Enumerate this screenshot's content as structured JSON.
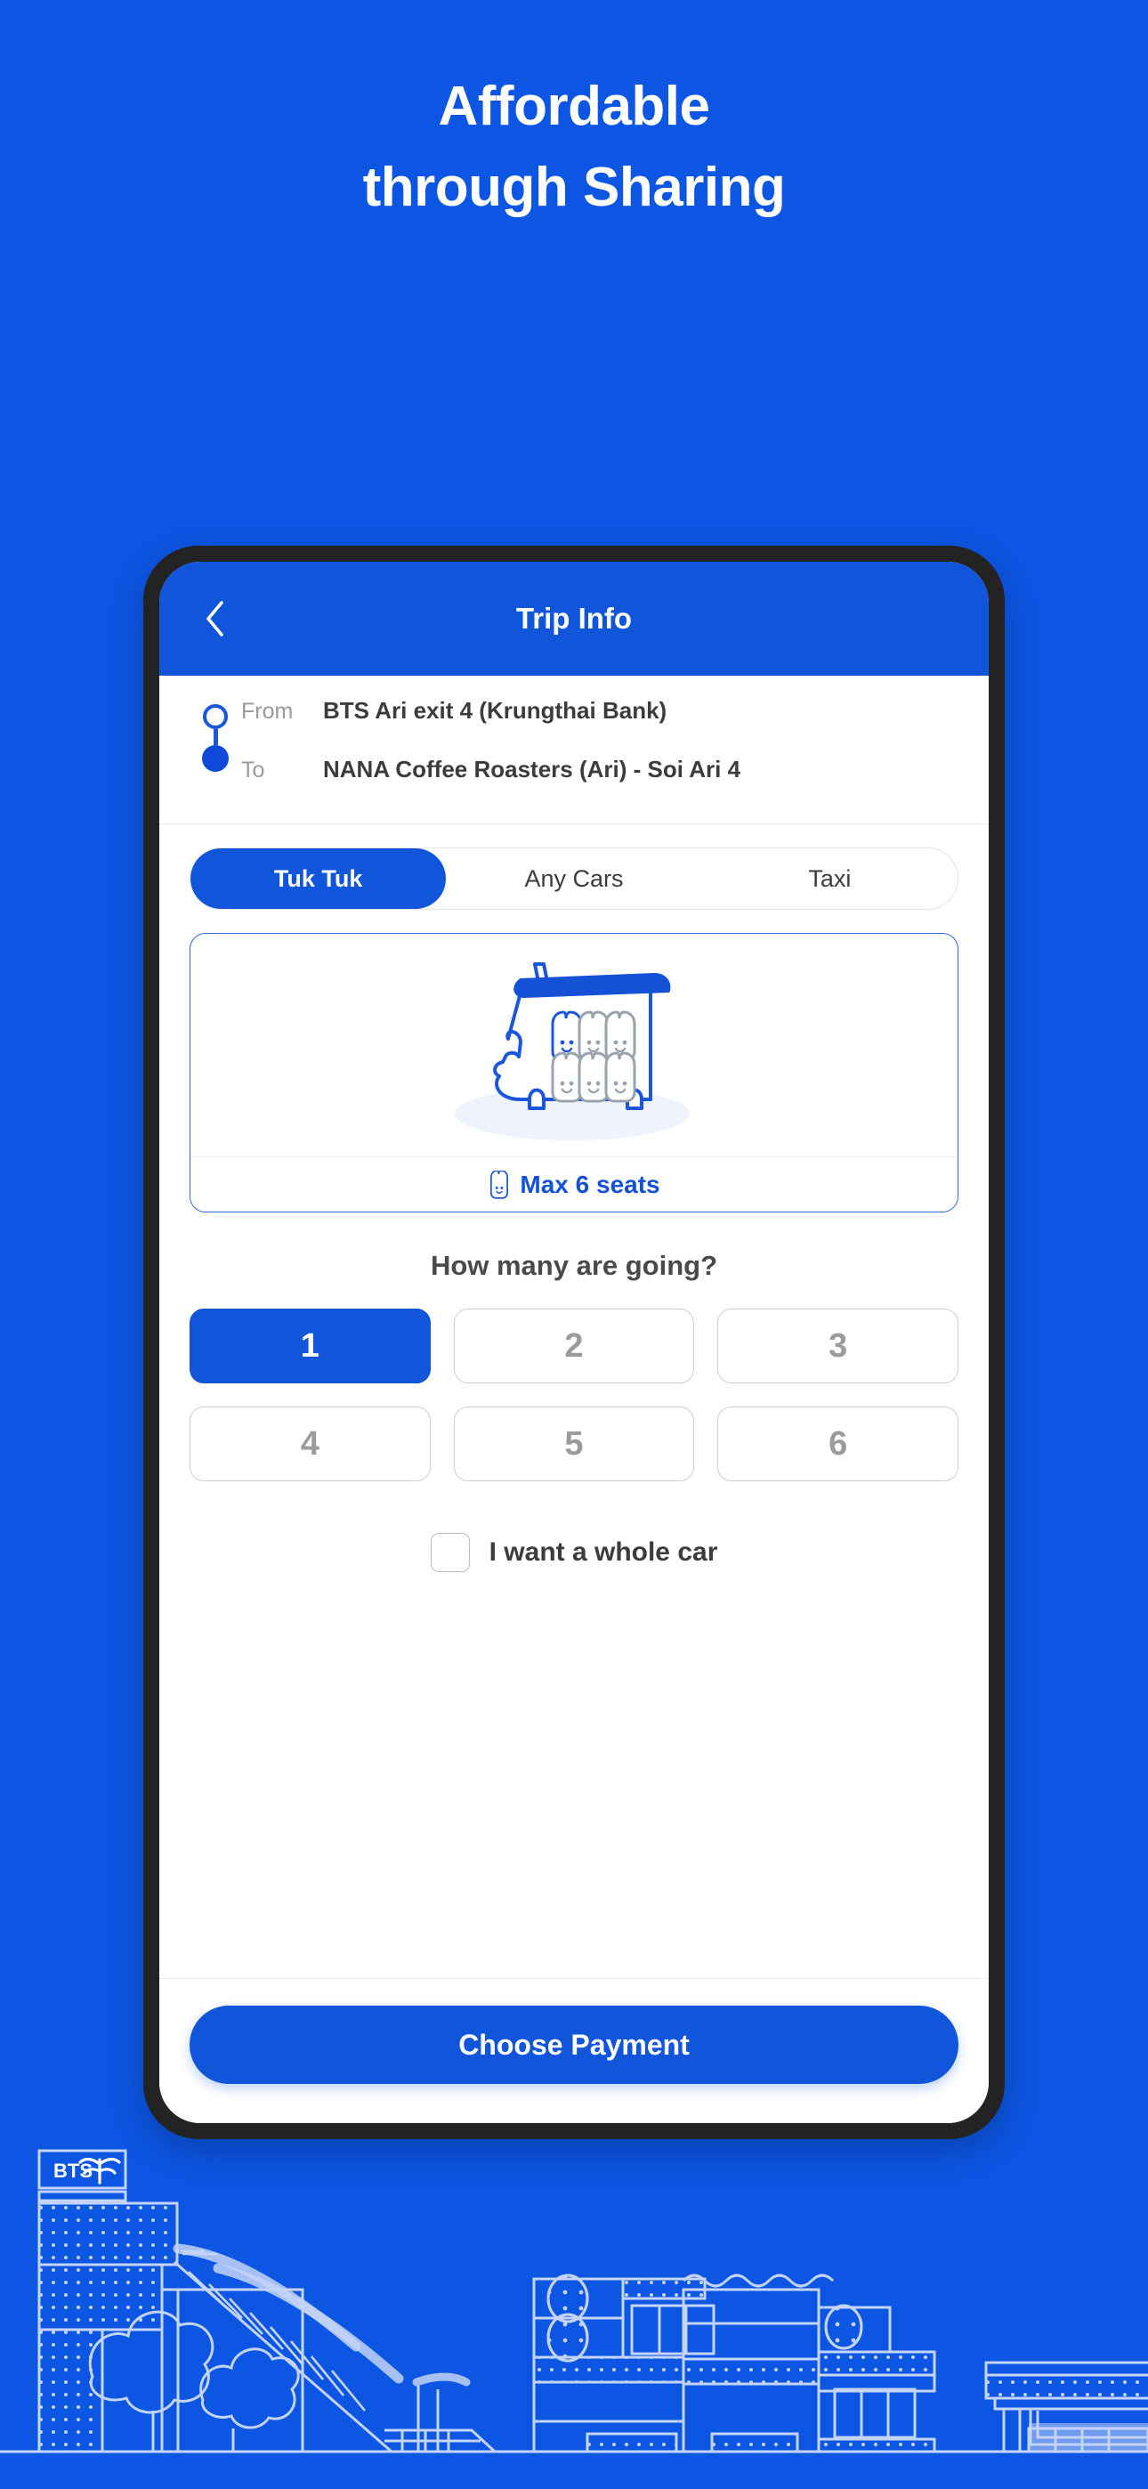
{
  "hero": {
    "line1": "Affordable",
    "line2": "through Sharing"
  },
  "colors": {
    "background_blue": "#0d55e3",
    "accent_blue": "#1055da",
    "frame_black": "#232323",
    "text_dark": "#3c3c3c",
    "text_muted": "#9a9a9a",
    "border_light": "#cfcfcf",
    "illustration_light": "#c3d4f7"
  },
  "app": {
    "header": {
      "title": "Trip Info",
      "back_icon": "chevron-left-icon"
    },
    "route": {
      "from_label": "From",
      "from_value": "BTS Ari exit 4 (Krungthai Bank)",
      "to_label": "To",
      "to_value": "NANA Coffee Roasters (Ari) - Soi Ari 4"
    },
    "tabs": [
      {
        "label": "Tuk Tuk",
        "active": true
      },
      {
        "label": "Any Cars",
        "active": false
      },
      {
        "label": "Taxi",
        "active": false
      }
    ],
    "vehicle": {
      "illustration": "tuk-tuk-illustration",
      "seat_icon": "seat-icon",
      "capacity_label": "Max 6 seats"
    },
    "passengers": {
      "question": "How many are going?",
      "options": [
        "1",
        "2",
        "3",
        "4",
        "5",
        "6"
      ],
      "selected": "1"
    },
    "whole_car": {
      "label": "I want a whole car",
      "checked": false
    },
    "cta": {
      "label": "Choose Payment"
    }
  },
  "cityscape": {
    "bts_sign_text": "BTS"
  }
}
